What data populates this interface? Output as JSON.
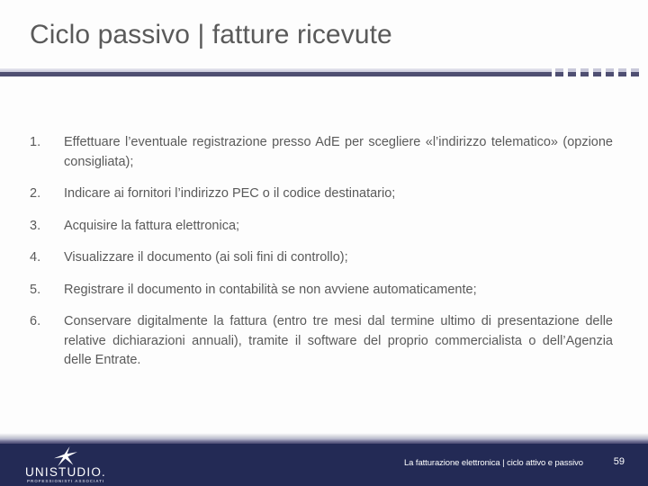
{
  "slide": {
    "title": "Ciclo passivo | fatture ricevute",
    "background_color": "#fdfdfd",
    "title_color": "#5a5a5a",
    "accent_color": "#4f4f72",
    "footer_color": "#232a55"
  },
  "rule": {
    "dash_count": 7
  },
  "content": {
    "items": [
      {
        "number": "1.",
        "text": "Effettuare l’eventuale registrazione presso AdE per scegliere «l’indirizzo telematico» (opzione consigliata);"
      },
      {
        "number": "2.",
        "text": "Indicare ai fornitori l’indirizzo PEC o il codice destinatario;"
      },
      {
        "number": "3.",
        "text": "Acquisire la fattura elettronica;"
      },
      {
        "number": "4.",
        "text": "Visualizzare il documento (ai soli fini di controllo);"
      },
      {
        "number": "5.",
        "text": "Registrare il documento in contabilità se non avviene automaticamente;"
      },
      {
        "number": "6.",
        "text": "Conservare digitalmente la fattura (entro tre mesi dal termine ultimo di presentazione delle relative dichiarazioni annuali), tramite il software del proprio commercialista o dell’Agenzia delle Entrate."
      }
    ]
  },
  "footer": {
    "logo_name": "UNISTUDIO.",
    "logo_subtitle": "PROFESSIONISTI ASSOCIATI",
    "text": "La fatturazione elettronica | ciclo attivo e passivo",
    "page_number": "59"
  }
}
